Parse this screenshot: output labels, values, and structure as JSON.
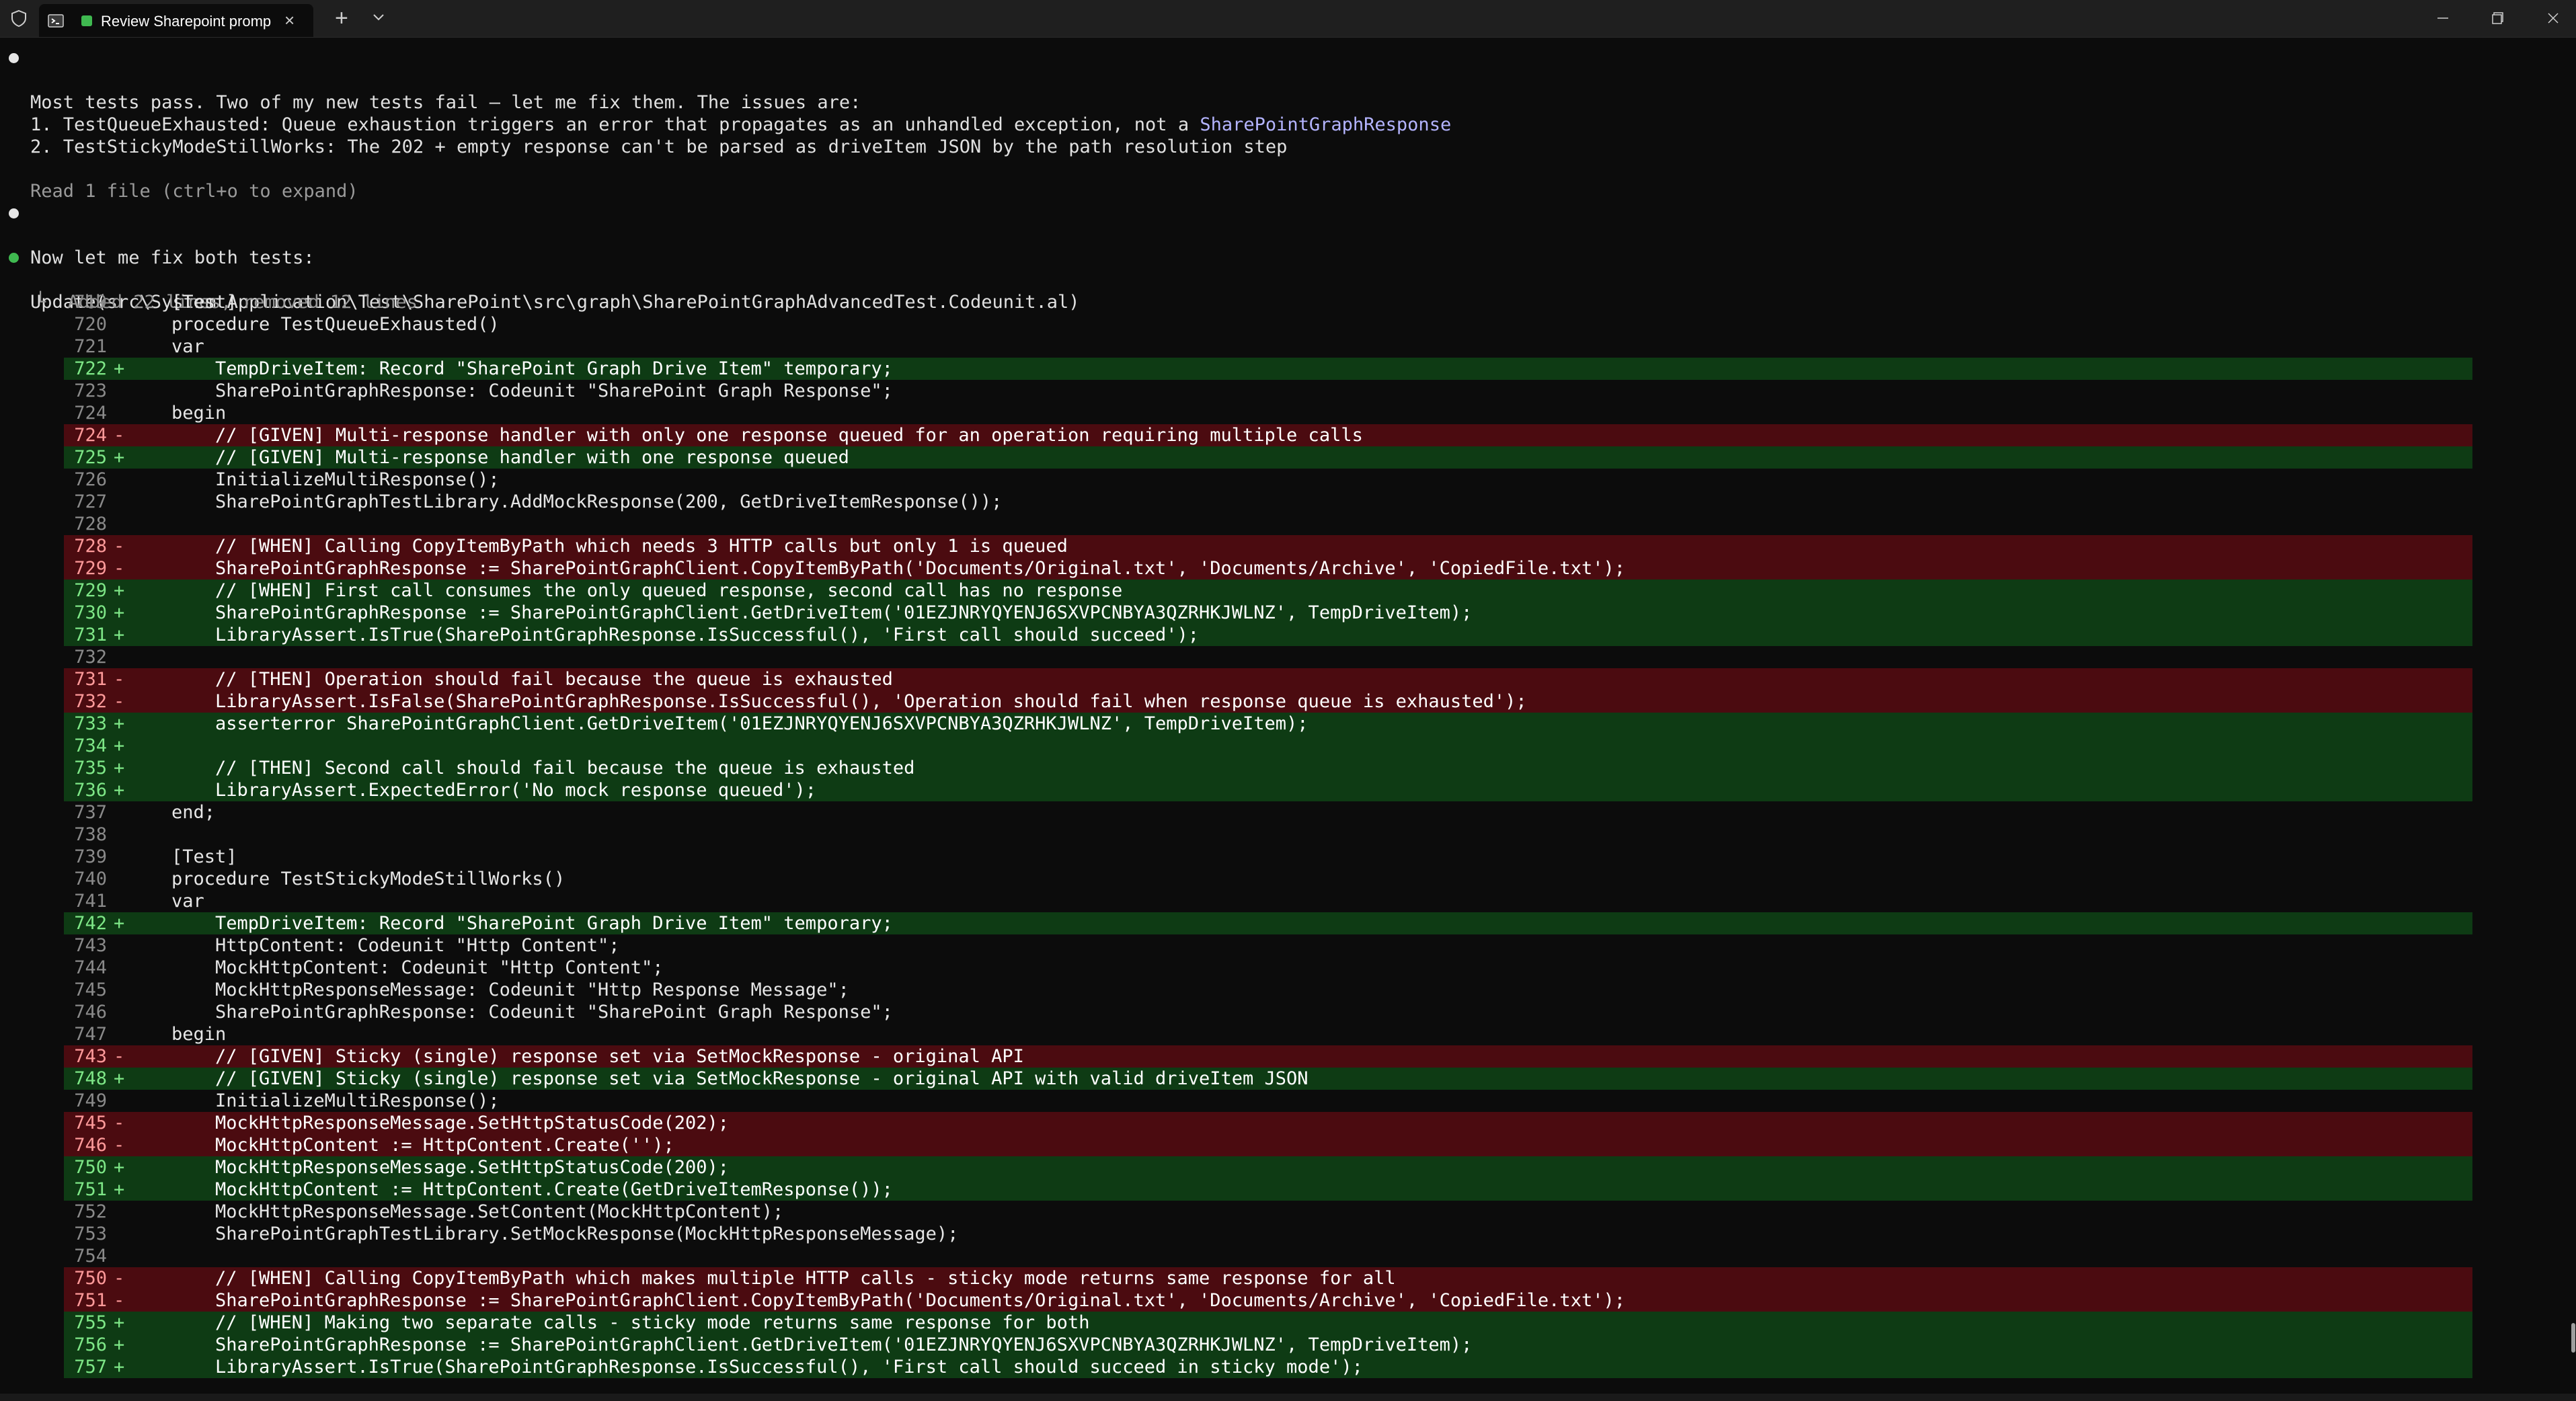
{
  "window": {
    "tab_title": "Review Sharepoint promp",
    "new_tab_symbol": "+",
    "close_tab_symbol": "×"
  },
  "messages": {
    "m1": "Most tests pass. Two of my new tests fail — let me fix them. The issues are:",
    "m2a": "1. TestQueueExhausted: Queue exhaustion triggers an error that propagates as an unhandled exception, not a ",
    "m2b": "SharePointGraphResponse",
    "m3": "2. TestStickyModeStillWorks: The 202 + empty response can't be parsed as driveItem JSON by the path resolution step",
    "m4": "Read 1 file (ctrl+o to expand)",
    "m5": "Now let me fix both tests:",
    "m6": "Update(src\\System Application\\Test\\SharePoint\\src\\graph\\SharePointGraphAdvancedTest.Codeunit.al)",
    "m7": "└  Added 22 lines, removed 12 lines"
  },
  "diff": [
    {
      "ln": "719",
      "t": "ctx",
      "code": "[Test]"
    },
    {
      "ln": "720",
      "t": "ctx",
      "code": "procedure TestQueueExhausted()"
    },
    {
      "ln": "721",
      "t": "ctx",
      "code": "var"
    },
    {
      "ln": "722",
      "t": "add",
      "code": "    TempDriveItem: Record \"SharePoint Graph Drive Item\" temporary;"
    },
    {
      "ln": "723",
      "t": "ctx",
      "code": "    SharePointGraphResponse: Codeunit \"SharePoint Graph Response\";"
    },
    {
      "ln": "724",
      "t": "ctx",
      "code": "begin"
    },
    {
      "ln": "724",
      "t": "del",
      "code": "    // [GIVEN] Multi-response handler with only one response queued for an operation requiring multiple calls"
    },
    {
      "ln": "725",
      "t": "add",
      "code": "    // [GIVEN] Multi-response handler with one response queued"
    },
    {
      "ln": "726",
      "t": "ctx",
      "code": "    InitializeMultiResponse();"
    },
    {
      "ln": "727",
      "t": "ctx",
      "code": "    SharePointGraphTestLibrary.AddMockResponse(200, GetDriveItemResponse());"
    },
    {
      "ln": "728",
      "t": "ctx",
      "code": ""
    },
    {
      "ln": "728",
      "t": "del",
      "code": "    // [WHEN] Calling CopyItemByPath which needs 3 HTTP calls but only 1 is queued"
    },
    {
      "ln": "729",
      "t": "del",
      "code": "    SharePointGraphResponse := SharePointGraphClient.CopyItemByPath('Documents/Original.txt', 'Documents/Archive', 'CopiedFile.txt');"
    },
    {
      "ln": "729",
      "t": "add",
      "code": "    // [WHEN] First call consumes the only queued response, second call has no response"
    },
    {
      "ln": "730",
      "t": "add",
      "code": "    SharePointGraphResponse := SharePointGraphClient.GetDriveItem('01EZJNRYQYENJ6SXVPCNBYA3QZRHKJWLNZ', TempDriveItem);"
    },
    {
      "ln": "731",
      "t": "add",
      "code": "    LibraryAssert.IsTrue(SharePointGraphResponse.IsSuccessful(), 'First call should succeed');"
    },
    {
      "ln": "732",
      "t": "ctx",
      "code": ""
    },
    {
      "ln": "731",
      "t": "del",
      "code": "    // [THEN] Operation should fail because the queue is exhausted"
    },
    {
      "ln": "732",
      "t": "del",
      "code": "    LibraryAssert.IsFalse(SharePointGraphResponse.IsSuccessful(), 'Operation should fail when response queue is exhausted');"
    },
    {
      "ln": "733",
      "t": "add",
      "code": "    asserterror SharePointGraphClient.GetDriveItem('01EZJNRYQYENJ6SXVPCNBYA3QZRHKJWLNZ', TempDriveItem);"
    },
    {
      "ln": "734",
      "t": "add",
      "code": ""
    },
    {
      "ln": "735",
      "t": "add",
      "code": "    // [THEN] Second call should fail because the queue is exhausted"
    },
    {
      "ln": "736",
      "t": "add",
      "code": "    LibraryAssert.ExpectedError('No mock response queued');"
    },
    {
      "ln": "737",
      "t": "ctx",
      "code": "end;"
    },
    {
      "ln": "738",
      "t": "ctx",
      "code": ""
    },
    {
      "ln": "739",
      "t": "ctx",
      "code": "[Test]"
    },
    {
      "ln": "740",
      "t": "ctx",
      "code": "procedure TestStickyModeStillWorks()"
    },
    {
      "ln": "741",
      "t": "ctx",
      "code": "var"
    },
    {
      "ln": "742",
      "t": "add",
      "code": "    TempDriveItem: Record \"SharePoint Graph Drive Item\" temporary;"
    },
    {
      "ln": "743",
      "t": "ctx",
      "code": "    HttpContent: Codeunit \"Http Content\";"
    },
    {
      "ln": "744",
      "t": "ctx",
      "code": "    MockHttpContent: Codeunit \"Http Content\";"
    },
    {
      "ln": "745",
      "t": "ctx",
      "code": "    MockHttpResponseMessage: Codeunit \"Http Response Message\";"
    },
    {
      "ln": "746",
      "t": "ctx",
      "code": "    SharePointGraphResponse: Codeunit \"SharePoint Graph Response\";"
    },
    {
      "ln": "747",
      "t": "ctx",
      "code": "begin"
    },
    {
      "ln": "743",
      "t": "del",
      "code": "    // [GIVEN] Sticky (single) response set via SetMockResponse - original API"
    },
    {
      "ln": "748",
      "t": "add",
      "code": "    // [GIVEN] Sticky (single) response set via SetMockResponse - original API with valid driveItem JSON"
    },
    {
      "ln": "749",
      "t": "ctx",
      "code": "    InitializeMultiResponse();"
    },
    {
      "ln": "745",
      "t": "del",
      "code": "    MockHttpResponseMessage.SetHttpStatusCode(202);"
    },
    {
      "ln": "746",
      "t": "del",
      "code": "    MockHttpContent := HttpContent.Create('');"
    },
    {
      "ln": "750",
      "t": "add",
      "code": "    MockHttpResponseMessage.SetHttpStatusCode(200);"
    },
    {
      "ln": "751",
      "t": "add",
      "code": "    MockHttpContent := HttpContent.Create(GetDriveItemResponse());"
    },
    {
      "ln": "752",
      "t": "ctx",
      "code": "    MockHttpResponseMessage.SetContent(MockHttpContent);"
    },
    {
      "ln": "753",
      "t": "ctx",
      "code": "    SharePointGraphTestLibrary.SetMockResponse(MockHttpResponseMessage);"
    },
    {
      "ln": "754",
      "t": "ctx",
      "code": ""
    },
    {
      "ln": "750",
      "t": "del",
      "code": "    // [WHEN] Calling CopyItemByPath which makes multiple HTTP calls - sticky mode returns same response for all"
    },
    {
      "ln": "751",
      "t": "del",
      "code": "    SharePointGraphResponse := SharePointGraphClient.CopyItemByPath('Documents/Original.txt', 'Documents/Archive', 'CopiedFile.txt');"
    },
    {
      "ln": "755",
      "t": "add",
      "code": "    // [WHEN] Making two separate calls - sticky mode returns same response for both"
    },
    {
      "ln": "756",
      "t": "add",
      "code": "    SharePointGraphResponse := SharePointGraphClient.GetDriveItem('01EZJNRYQYENJ6SXVPCNBYA3QZRHKJWLNZ', TempDriveItem);"
    },
    {
      "ln": "757",
      "t": "add",
      "code": "    LibraryAssert.IsTrue(SharePointGraphResponse.IsSuccessful(), 'First call should succeed in sticky mode');"
    }
  ]
}
